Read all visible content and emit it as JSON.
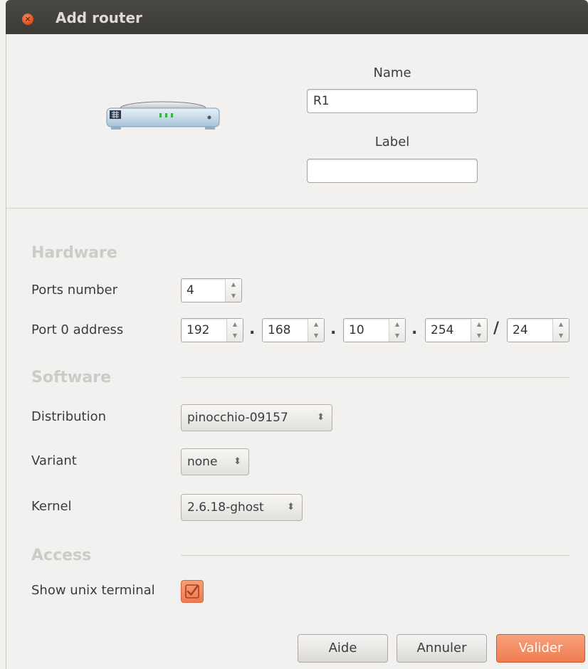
{
  "window": {
    "title": "Add router"
  },
  "router_icon": {
    "icon": "router-icon"
  },
  "identity": {
    "name_label": "Name",
    "name_value": "R1",
    "label_label": "Label",
    "label_value": ""
  },
  "hardware": {
    "section_title": "Hardware",
    "ports_label": "Ports number",
    "ports_value": "4",
    "address_label": "Port 0 address",
    "octet1": "192",
    "octet2": "168",
    "octet3": "10",
    "octet4": "254",
    "dot": ".",
    "slash": "/",
    "prefix": "24"
  },
  "software": {
    "section_title": "Software",
    "distribution_label": "Distribution",
    "distribution_value": "pinocchio-09157",
    "variant_label": "Variant",
    "variant_value": "none",
    "kernel_label": "Kernel",
    "kernel_value": "2.6.18-ghost"
  },
  "access": {
    "section_title": "Access",
    "terminal_label": "Show unix terminal",
    "terminal_checked": true
  },
  "buttons": {
    "help": "Aide",
    "cancel": "Annuler",
    "ok": "Valider"
  },
  "colors": {
    "accent": "#ef7b50",
    "titlebar": "#3c3b37",
    "section": "#cdcbc8"
  }
}
